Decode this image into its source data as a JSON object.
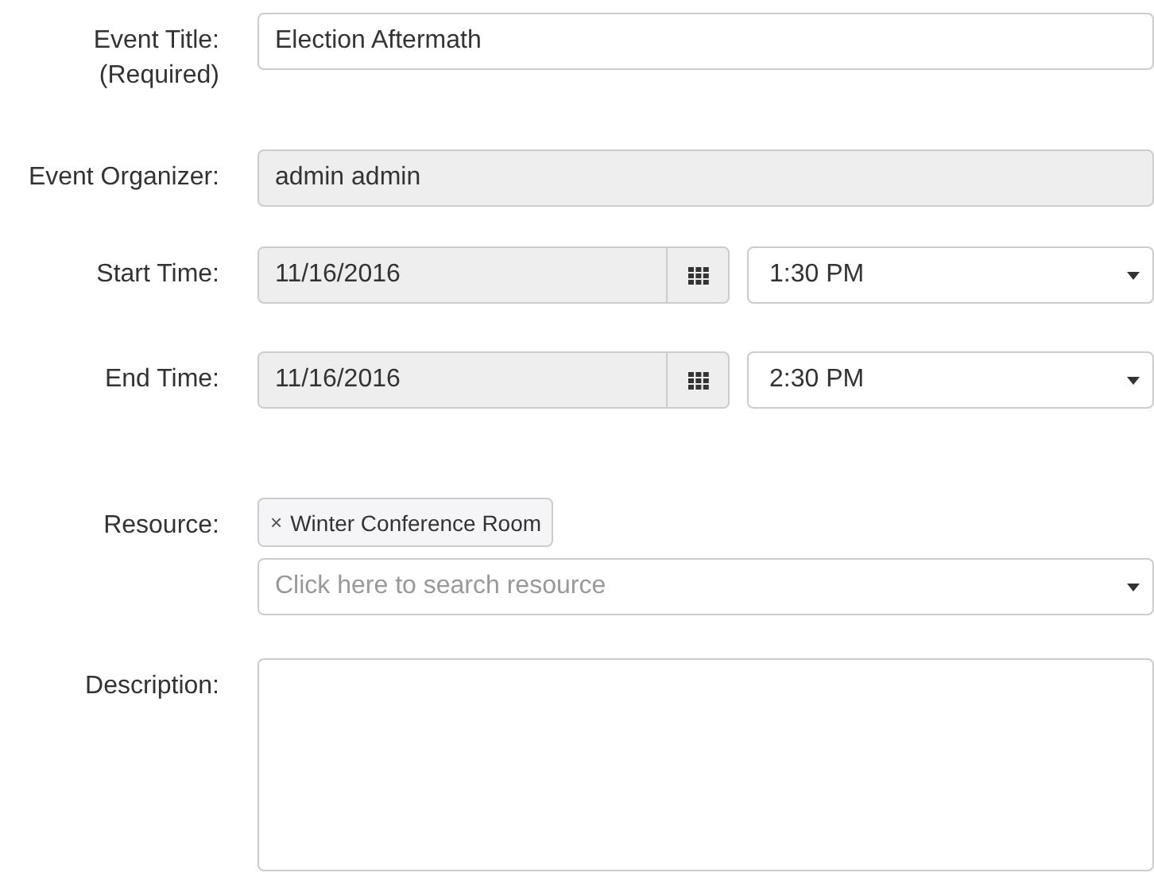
{
  "fields": [
    {
      "kind": "text",
      "label": "Event Title:",
      "note": "(Required)",
      "value": "Election Aftermath",
      "disabled": false
    },
    {
      "kind": "text",
      "label": "Event Organizer:",
      "value": "admin admin",
      "disabled": true
    },
    {
      "kind": "datetime",
      "label": "Start Time:",
      "date": "11/16/2016",
      "time": "1:30 PM"
    },
    {
      "kind": "datetime",
      "label": "End Time:",
      "date": "11/16/2016",
      "time": "2:30 PM"
    },
    {
      "kind": "resource",
      "label": "Resource:",
      "tags": [
        {
          "label": "Winter Conference Room",
          "remove": "×"
        }
      ],
      "placeholder": "Click here to search resource"
    },
    {
      "kind": "textarea",
      "label": "Description:"
    }
  ]
}
